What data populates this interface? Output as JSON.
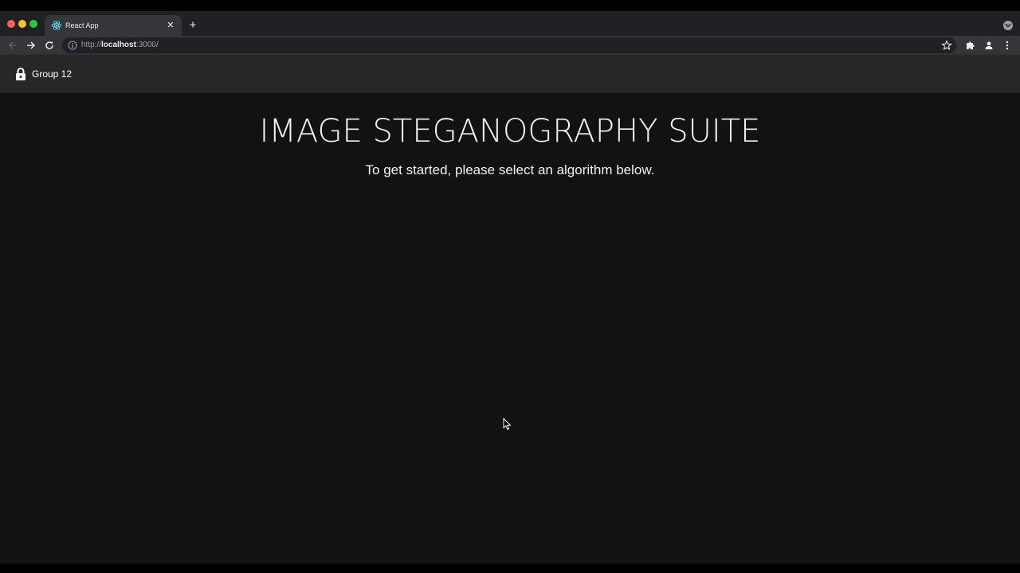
{
  "browser": {
    "tab": {
      "title": "React App",
      "close_glyph": "✕",
      "favicon_icon": "react-atom-icon"
    },
    "new_tab_glyph": "+",
    "address_bar": {
      "scheme": "http://",
      "host": "localhost",
      "rest": ":3000/"
    },
    "icons": [
      "back-arrow-icon",
      "forward-arrow-icon",
      "reload-icon",
      "info-icon",
      "star-icon",
      "puzzle-extension-icon",
      "profile-icon",
      "kebab-menu-icon",
      "tab-search-icon"
    ]
  },
  "appbar": {
    "brand": "Group 12",
    "icon": "lock-icon"
  },
  "main": {
    "title": "IMAGE STEGANOGRAPHY SUITE",
    "subtitle": "To get started, please select an algorithm below."
  },
  "colors": {
    "tabstrip_bg": "#202124",
    "toolbar_bg": "#35363a",
    "appbar_bg": "#272727",
    "content_bg": "#121212",
    "text": "#f2f2f2",
    "traffic_red": "#ff5f57",
    "traffic_yellow": "#febc2e",
    "traffic_green": "#28c840"
  }
}
